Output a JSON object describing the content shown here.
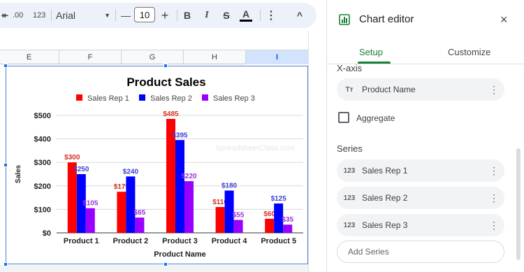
{
  "toolbar": {
    "decimal_more": ".00",
    "format_123": "123",
    "font": "Arial",
    "font_size": "10",
    "bold": "B",
    "italic": "I",
    "strike": "S",
    "text_color": "A",
    "minus": "—",
    "plus": "+",
    "more": "⋮",
    "collapse": "^"
  },
  "columns": [
    "E",
    "F",
    "G",
    "H",
    "I"
  ],
  "chart_data": {
    "type": "bar",
    "title": "Product Sales",
    "xlabel": "Product Name",
    "ylabel": "Sales",
    "categories": [
      "Product 1",
      "Product 2",
      "Product 3",
      "Product 4",
      "Product 5"
    ],
    "series": [
      {
        "name": "Sales Rep 1",
        "color": "#ff0000",
        "values": [
          300,
          175,
          485,
          110,
          60
        ]
      },
      {
        "name": "Sales Rep 2",
        "color": "#0000ff",
        "values": [
          250,
          240,
          395,
          180,
          125
        ]
      },
      {
        "name": "Sales Rep 3",
        "color": "#9900ff",
        "values": [
          105,
          65,
          220,
          55,
          35
        ]
      }
    ],
    "data_labels": [
      [
        "$300",
        "$175",
        "$485",
        "$110",
        "$60"
      ],
      [
        "$250",
        "$240",
        "$395",
        "$180",
        "$125"
      ],
      [
        "$105",
        "$65",
        "$220",
        "$55",
        "$35"
      ]
    ],
    "yticks": [
      "$0",
      "$100",
      "$200",
      "$300",
      "$400",
      "$500"
    ],
    "ylim": [
      0,
      500
    ],
    "legend_position": "top",
    "watermark": "SpreadsheetClass.com",
    "grid": true
  },
  "editor": {
    "title": "Chart editor",
    "close": "×",
    "tabs": [
      "Setup",
      "Customize"
    ],
    "xaxis_label": "X-axis",
    "xaxis_field": {
      "icon": "Tт",
      "label": "Product Name"
    },
    "aggregate_label": "Aggregate",
    "series_label": "Series",
    "series": [
      {
        "icon": "123",
        "label": "Sales Rep 1"
      },
      {
        "icon": "123",
        "label": "Sales Rep 2"
      },
      {
        "icon": "123",
        "label": "Sales Rep 3"
      }
    ],
    "kebab": "⋮",
    "add_series": "Add Series"
  }
}
